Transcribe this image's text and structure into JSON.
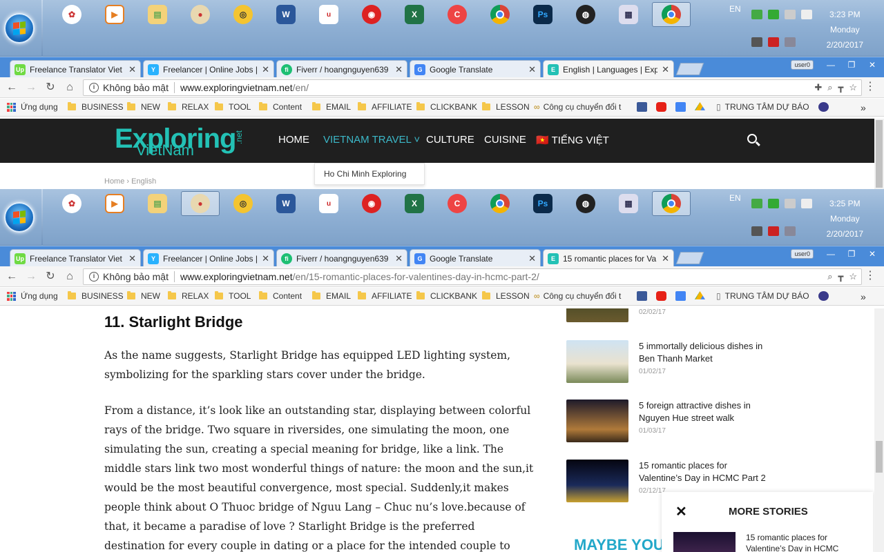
{
  "screen1": {
    "taskbar": {
      "lang": "EN",
      "time": "3:23 PM",
      "day": "Monday",
      "date": "2/20/2017"
    },
    "tabs": [
      {
        "label": "Freelance Translator Viet",
        "favicon": "upwork-icon"
      },
      {
        "label": "Freelancer | Online Jobs |",
        "favicon": "freelancer-icon"
      },
      {
        "label": "Fiverr / hoangnguyen639",
        "favicon": "fiverr-icon"
      },
      {
        "label": "Google Translate",
        "favicon": "google-translate-icon"
      },
      {
        "label": "English | Languages | Exp",
        "favicon": "exploring-icon"
      }
    ],
    "user": "user0",
    "omnibox": {
      "security": "Không bảo mật",
      "host": "www.exploringvietnam.net",
      "path": "/en/"
    }
  },
  "screen2": {
    "taskbar": {
      "lang": "EN",
      "time": "3:25 PM",
      "day": "Monday",
      "date": "2/20/2017"
    },
    "tabs": [
      {
        "label": "Freelance Translator Viet",
        "favicon": "upwork-icon"
      },
      {
        "label": "Freelancer | Online Jobs |",
        "favicon": "freelancer-icon"
      },
      {
        "label": "Fiverr / hoangnguyen639",
        "favicon": "fiverr-icon"
      },
      {
        "label": "Google Translate",
        "favicon": "google-translate-icon"
      },
      {
        "label": "15 romantic places for Va",
        "favicon": "exploring-icon"
      }
    ],
    "user": "user0",
    "omnibox": {
      "security": "Không bảo mật",
      "host": "www.exploringvietnam.net",
      "path": "/en/15-romantic-places-for-valentines-day-in-hcmc-part-2/"
    }
  },
  "bookmarks": [
    "Ứng dụng",
    "BUSINESS",
    "NEW",
    "RELAX",
    "TOOL",
    "Content",
    "EMAIL",
    "AFFILIATE",
    "CLICKBANK",
    "LESSON",
    "Công cụ chuyển đổi t",
    "TRUNG TÂM DỰ BÁO"
  ],
  "site": {
    "logo": "Exploring",
    "logo_sub": "VietNam",
    "logo_net": ".net",
    "nav": [
      "HOME",
      "VIETNAM TRAVEL ˅",
      "CULTURE",
      "CUISINE",
      "🇻🇳 TIẾNG VIỆT"
    ],
    "dropdown_item": "Ho Chi Minh Exploring",
    "breadcrumb": "Home  ›  English"
  },
  "article": {
    "heading": "11. Starlight Bridge",
    "para1": "As the name suggests, Starlight Bridge has equipped LED lighting system, symbolizing for the sparkling stars cover under the bridge.",
    "para2": "From a distance, it’s look like an outstanding star, displaying between colorful rays of the bridge. Two square in riversides, one simulating the moon, one simulating the sun, creating a special meaning for bridge, like a link. The middle stars link two most wonderful things of nature: the moon and the sun,it would be the most beautiful convergence, most special. Suddenly,it makes people think about O Thuoc bridge of Nguu Lang – Chuc nu’s love.because of that, it became a paradise of love ? Starlight Bridge is the preferred destination for every couple in dating or a place for the intended couple to store lots of romantic images."
  },
  "sidebar": [
    {
      "title": "",
      "date": "02/02/17"
    },
    {
      "title": "5 immortally delicious dishes in Ben Thanh Market",
      "date": "01/02/17"
    },
    {
      "title": "5 foreign attractive dishes in Nguyen Hue street walk",
      "date": "01/03/17"
    },
    {
      "title": "15 romantic places for Valentine’s Day in HCMC Part 2",
      "date": "02/12/17"
    }
  ],
  "maybe_heading": "MAYBE YOU",
  "more_stories": {
    "title": "MORE STORIES",
    "close": "✕",
    "item": "15 romantic places for Valentine’s Day in HCMC"
  },
  "colors": {
    "accent": "#23c1b5",
    "nav_highlight": "#3cb8c8",
    "header_bg": "#1f1f1f",
    "tabstrip": "#4a8bd9"
  }
}
